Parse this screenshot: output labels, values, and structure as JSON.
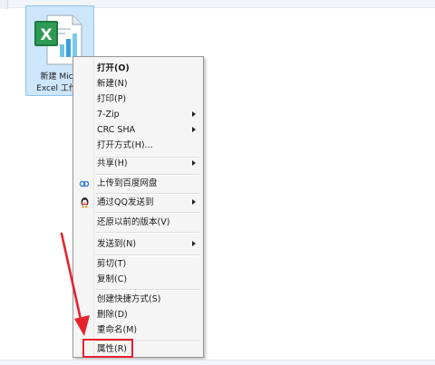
{
  "file": {
    "name_line1": "新建 Micro",
    "name_line2": "Excel 工作表",
    "icon": "excel-file-icon",
    "icon_letter": "X"
  },
  "menu": {
    "items": [
      {
        "label": "打开(O)",
        "bold": true
      },
      {
        "label": "新建(N)"
      },
      {
        "label": "打印(P)"
      },
      {
        "label": "7-Zip",
        "submenu": true
      },
      {
        "label": "CRC SHA",
        "submenu": true
      },
      {
        "label": "打开方式(H)..."
      },
      {
        "label": "共享(H)",
        "submenu": true
      },
      {
        "label": "上传到百度网盘",
        "icon": "baidu-netdisk-icon"
      },
      {
        "label": "通过QQ发送到",
        "icon": "qq-penguin-icon",
        "submenu": true
      },
      {
        "label": "还原以前的版本(V)"
      },
      {
        "label": "发送到(N)",
        "submenu": true
      },
      {
        "label": "剪切(T)"
      },
      {
        "label": "复制(C)"
      },
      {
        "label": "创建快捷方式(S)"
      },
      {
        "label": "删除(D)"
      },
      {
        "label": "重命名(M)"
      },
      {
        "label": "属性(R)",
        "highlighted": true
      }
    ]
  },
  "colors": {
    "menu_background": "#f5f5f5",
    "selection_background": "#cde6fb",
    "selection_border": "#8ec2ee",
    "annotation_red": "#e5232e",
    "excel_green": "#1f7a3f"
  }
}
